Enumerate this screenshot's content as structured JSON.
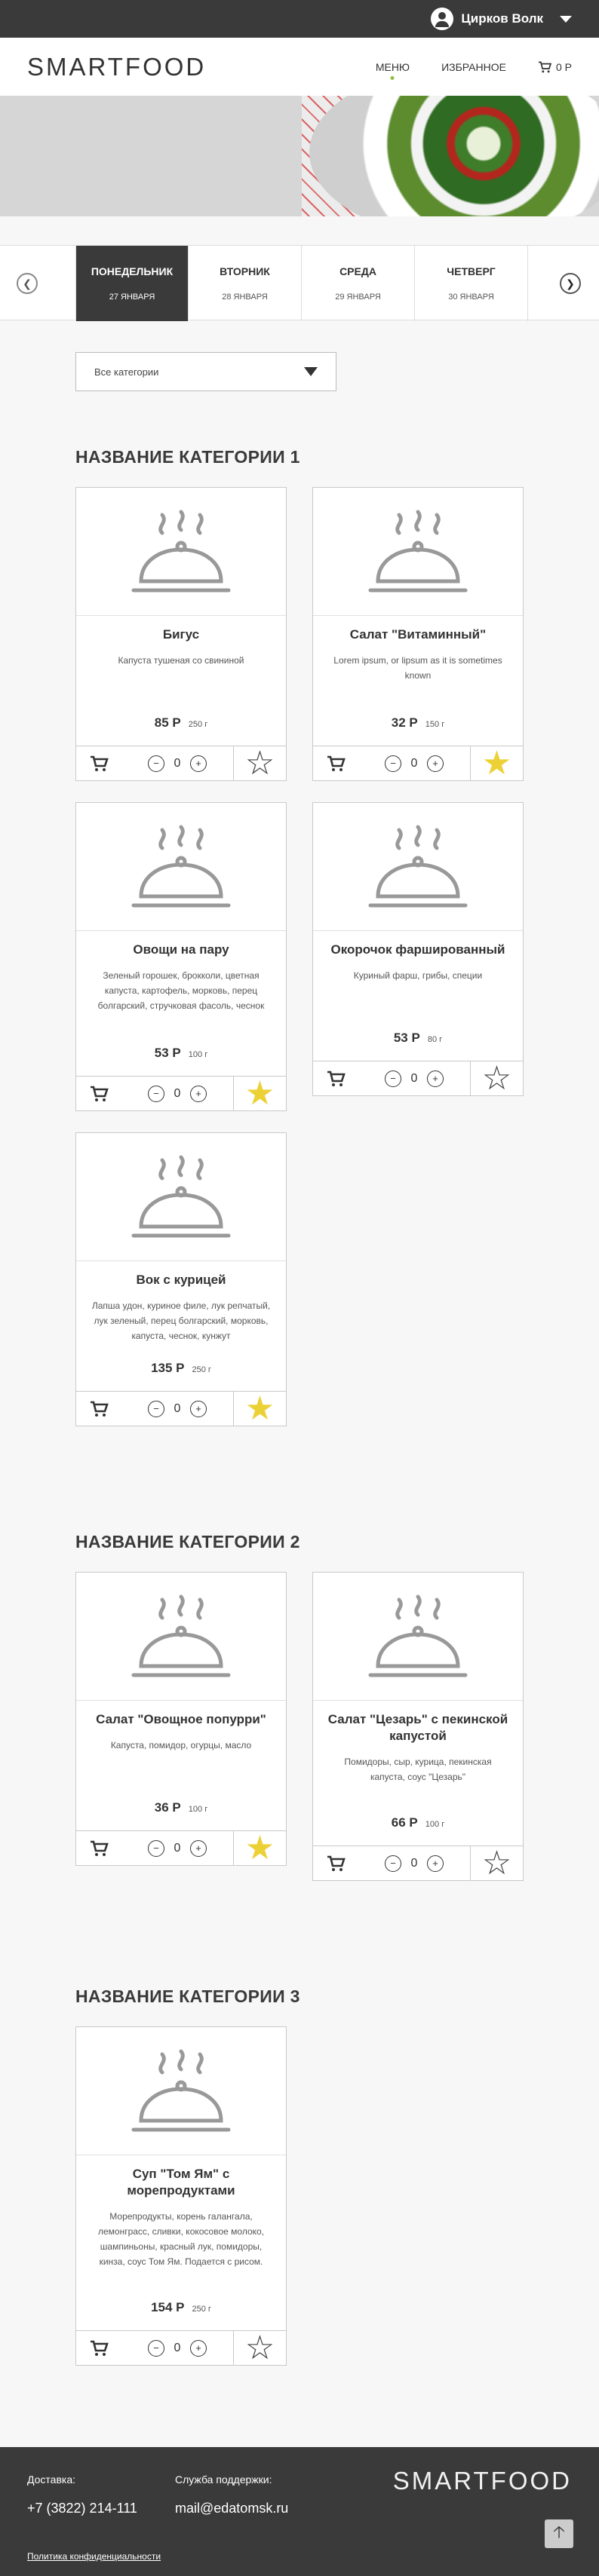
{
  "user": {
    "name": "Цирков Волк"
  },
  "brand": {
    "logo_left": "SMARTF",
    "logo_oo": "OO",
    "logo_right": "D"
  },
  "nav": {
    "menu": "МЕНЮ",
    "favorites": "ИЗБРАННОЕ",
    "cart_total": "0 Р"
  },
  "days": [
    {
      "name": "ПОНЕДЕЛЬНИК",
      "date": "27 ЯНВАРЯ"
    },
    {
      "name": "ВТОРНИК",
      "date": "28 ЯНВАРЯ"
    },
    {
      "name": "СРЕДА",
      "date": "29 ЯНВАРЯ"
    },
    {
      "name": "ЧЕТВЕРГ",
      "date": "30 ЯНВАРЯ"
    }
  ],
  "filter": {
    "selected": "Все категории"
  },
  "categories": [
    {
      "title": "НАЗВАНИЕ КАТЕГОРИИ 1",
      "items": [
        {
          "name": "Бигус",
          "desc": "Капуста тушеная со свининой",
          "price": "85 Р",
          "weight": "250 г",
          "qty": "0",
          "favorite": false
        },
        {
          "name": "Салат \"Витаминный\"",
          "desc": "Lorem ipsum, or lipsum as it is sometimes known",
          "price": "32 Р",
          "weight": "150 г",
          "qty": "0",
          "favorite": true
        },
        {
          "name": "Овощи на пару",
          "desc": "Зеленый горошек, брокколи, цветная капуста, картофель, морковь, перец болгарский, стручковая фасоль, чеснок",
          "price": "53 Р",
          "weight": "100 г",
          "qty": "0",
          "favorite": true
        },
        {
          "name": "Окорочок фаршированный",
          "desc": "Куриный фарш, грибы, специи",
          "price": "53 Р",
          "weight": "80 г",
          "qty": "0",
          "favorite": false
        },
        {
          "name": "Вок с курицей",
          "desc": "Лапша удон, куриное филе, лук репчатый, лук зеленый, перец болгарский, морковь, капуста, чеснок, кунжут",
          "price": "135 Р",
          "weight": "250 г",
          "qty": "0",
          "favorite": true
        }
      ]
    },
    {
      "title": "НАЗВАНИЕ КАТЕГОРИИ 2",
      "items": [
        {
          "name": "Салат \"Овощное попурри\"",
          "desc": "Капуста, помидор, огурцы, масло",
          "price": "36 Р",
          "weight": "100 г",
          "qty": "0",
          "favorite": true
        },
        {
          "name": "Салат \"Цезарь\" с пекинской капустой",
          "desc": "Помидоры, сыр, курица, пекинская капуста, соус \"Цезарь\"",
          "price": "66 Р",
          "weight": "100 г",
          "qty": "0",
          "favorite": false
        }
      ]
    },
    {
      "title": "НАЗВАНИЕ КАТЕГОРИИ 3",
      "items": [
        {
          "name": "Суп \"Том Ям\" с морепродуктами",
          "desc": "Морепродукты, корень галангала, лемонграсс, сливки, кокосовое молоко, шампиньоны, красный лук, помидоры, кинза, соус Том Ям. Подается с рисом.",
          "price": "154 Р",
          "weight": "250 г",
          "qty": "0",
          "favorite": false
        }
      ]
    }
  ],
  "footer": {
    "delivery_label": "Доставка:",
    "phone": "+7 (3822) 214-111",
    "support_label": "Служба поддержки:",
    "email": "mail@edatomsk.ru",
    "policy": "Политика конфиденциальности"
  },
  "colors": {
    "dark": "#3a3a3a",
    "accent_green": "#8fbf3f",
    "star_on": "#ecd136"
  }
}
